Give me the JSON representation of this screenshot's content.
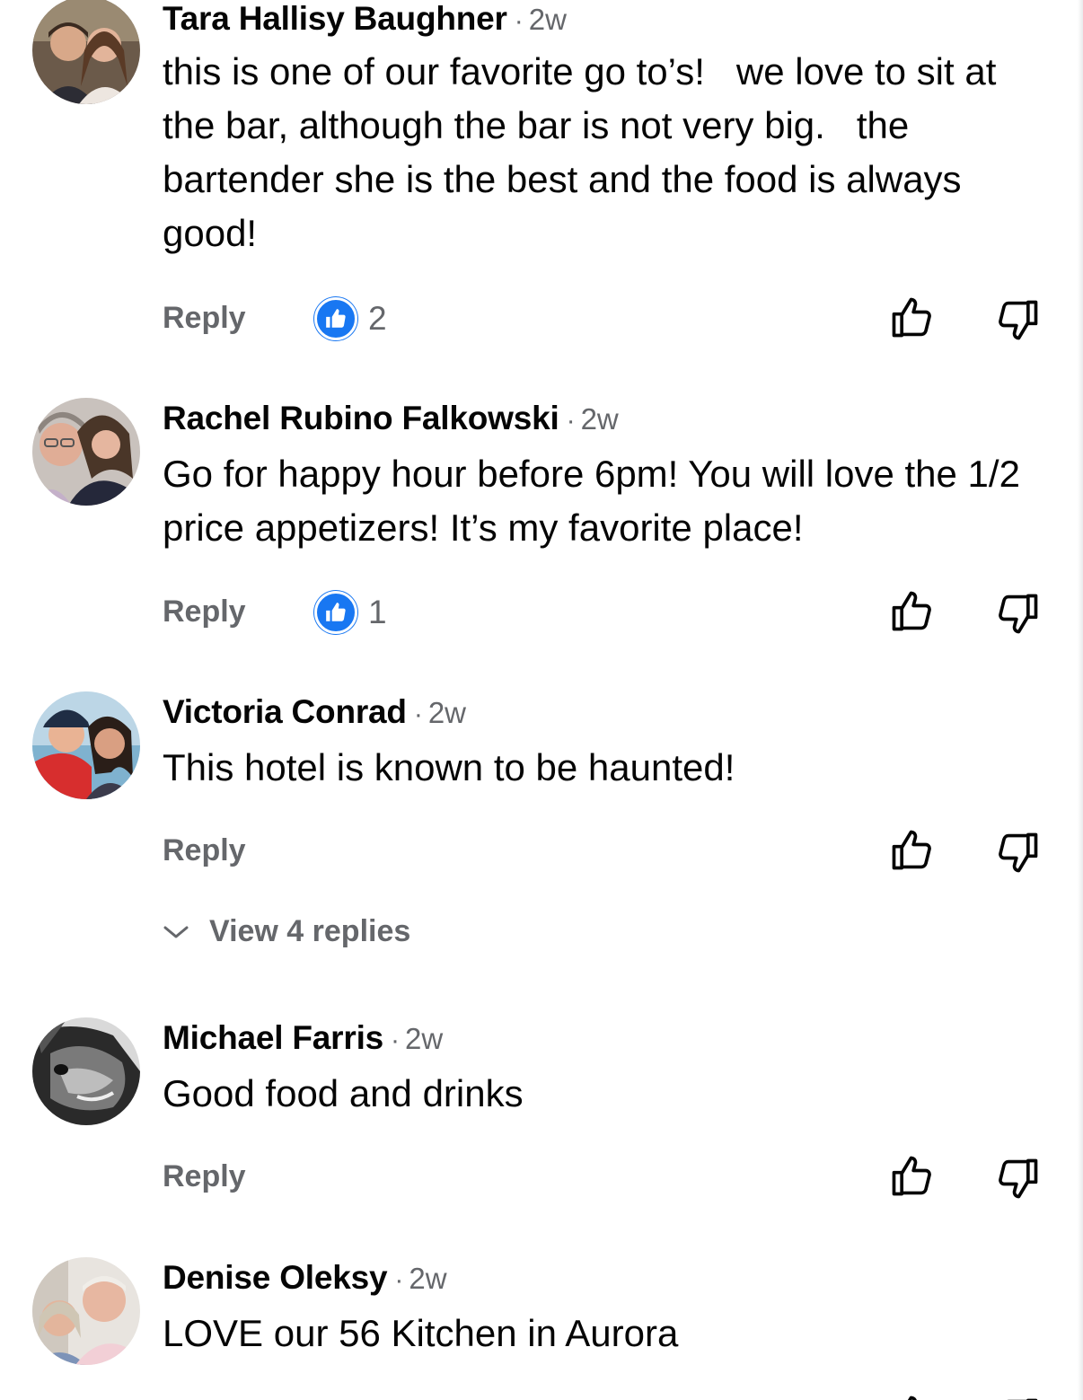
{
  "comments": [
    {
      "author": "Tara Hallisy Baughner",
      "time": "2w",
      "text": "this is one of our favorite go to’s!   we love to sit at the bar, although the bar is not very big.   the bartender she is the best and the food is always good!",
      "reply_label": "Reply",
      "reaction_count": "2"
    },
    {
      "author": "Rachel Rubino Falkowski",
      "time": "2w",
      "text": "Go for happy hour before 6pm! You will love the 1/2 price appetizers! It’s my favorite place!",
      "reply_label": "Reply",
      "reaction_count": "1"
    },
    {
      "author": "Victoria Conrad",
      "time": "2w",
      "text": "This hotel is known to be haunted!",
      "reply_label": "Reply",
      "view_replies_label": "View 4 replies"
    },
    {
      "author": "Michael Farris",
      "time": "2w",
      "text": "Good food and drinks",
      "reply_label": "Reply"
    },
    {
      "author": "Denise Oleksy",
      "time": "2w",
      "text": "LOVE our 56 Kitchen in Aurora"
    }
  ],
  "separator": "·",
  "colors": {
    "text": "#050505",
    "secondary": "#65676b",
    "reaction_blue": "#1877f2"
  },
  "icons": {
    "reaction": "like-reaction-icon",
    "upvote": "thumbs-up-outline-icon",
    "downvote": "thumbs-down-outline-icon",
    "expand": "chevron-down-icon"
  }
}
